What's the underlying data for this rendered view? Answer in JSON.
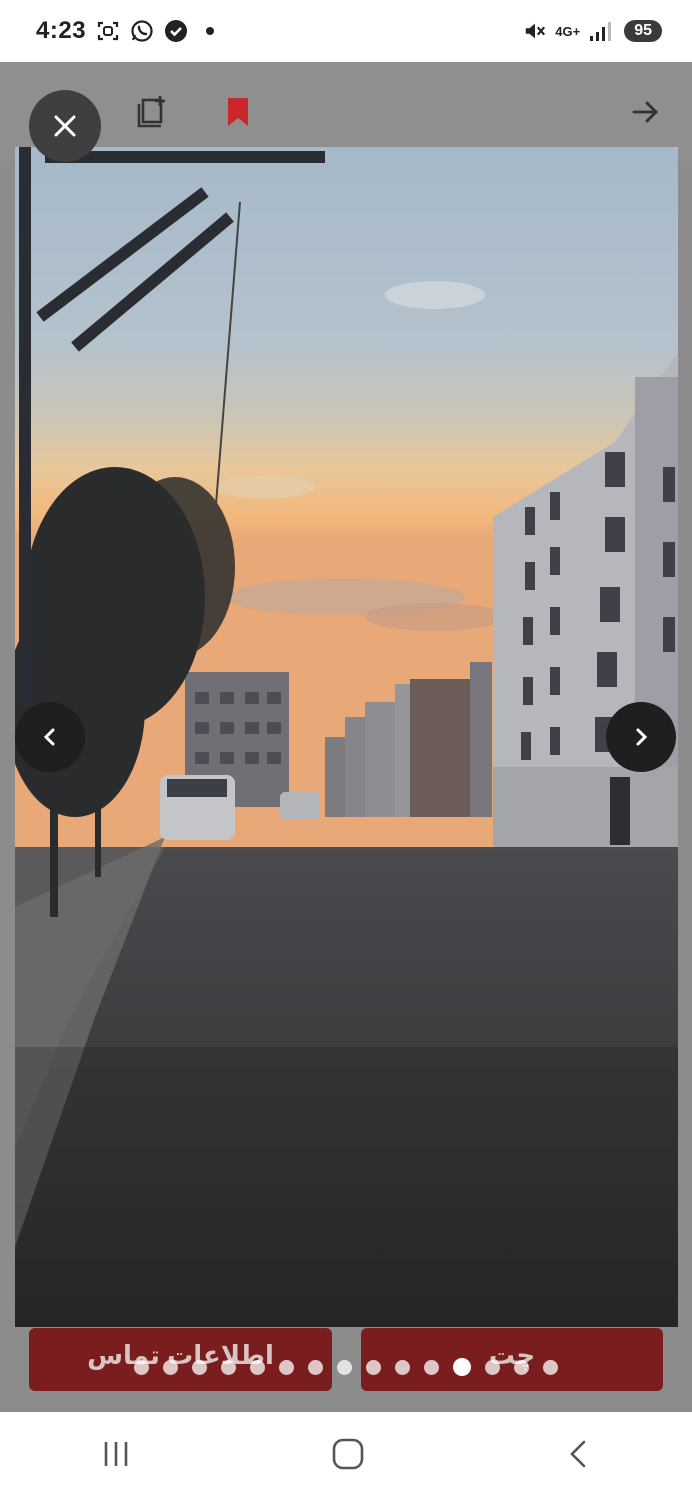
{
  "status_bar": {
    "time": "4:23",
    "network": "4G+",
    "battery": "95",
    "icons": [
      "screenshot-icon",
      "whatsapp-icon",
      "shield-check-icon",
      "dot-icon",
      "mute-icon",
      "signal-icon"
    ]
  },
  "header": {
    "icons": [
      "add-to-list-icon",
      "bookmark-icon",
      "forward-arrow-icon"
    ],
    "bookmark_color": "#d42a2f"
  },
  "actions": {
    "contact_label": "اطلاعات تماس",
    "chat_label": "چت"
  },
  "gallery": {
    "image_count": 15,
    "active_index": 11,
    "photo_description_icon": "street-photo"
  },
  "system_nav": {
    "icons": [
      "recents-icon",
      "home-icon",
      "back-icon"
    ]
  }
}
